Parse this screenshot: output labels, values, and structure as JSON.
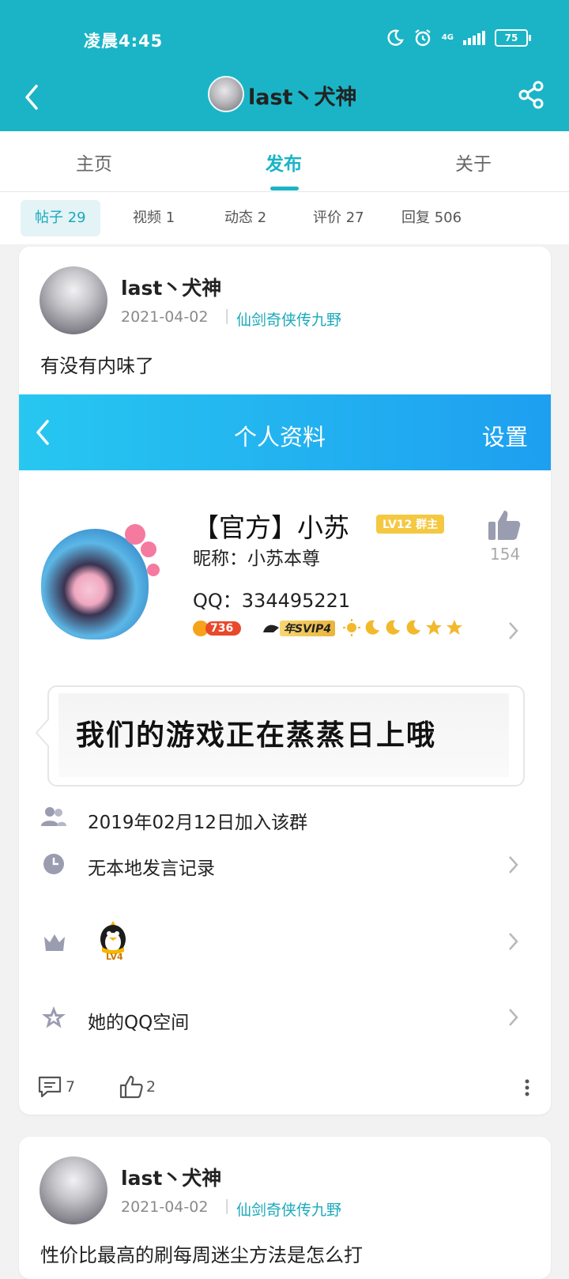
{
  "status_bar": {
    "time": "凌晨4:45",
    "battery": "75",
    "network": "4G"
  },
  "header": {
    "title": "last丶犬神"
  },
  "tabs": [
    {
      "label": "主页"
    },
    {
      "label": "发布",
      "active": true
    },
    {
      "label": "关于"
    }
  ],
  "subtabs": [
    {
      "label": "帖子 29",
      "active": true
    },
    {
      "label": "视频 1"
    },
    {
      "label": "动态 2"
    },
    {
      "label": "评价 27"
    },
    {
      "label": "回复 506"
    }
  ],
  "posts": [
    {
      "author": "last丶犬神",
      "date": "2021-04-02",
      "game": "仙剑奇侠传九野",
      "text": "有没有内味了",
      "image": {
        "bar_title": "个人资料",
        "bar_right": "设置",
        "profile_name": "【官方】小苏",
        "level_badge": "LV12 群主",
        "like_count": "154",
        "nickname_line": "昵称：小苏本尊",
        "qq_line": "QQ：334495221",
        "coin_value": "736",
        "vip_label": "年SVIP4",
        "message_text": "我们的游戏正在蒸蒸日上哦",
        "join_text": "2019年02月12日加入该群",
        "history_text": "无本地发言记录",
        "penguin_level": "LV4",
        "zone_text": "她的QQ空间"
      },
      "comments": "7",
      "likes": "2"
    },
    {
      "author": "last丶犬神",
      "date": "2021-04-02",
      "game": "仙剑奇侠传九野",
      "text": "性价比最高的刷每周迷尘方法是怎么打"
    }
  ],
  "colors": {
    "accent": "#1ab4c6",
    "link": "#1aa9bb",
    "bar_gradient_start": "#27c7f0",
    "bar_gradient_end": "#1e9ff0"
  }
}
